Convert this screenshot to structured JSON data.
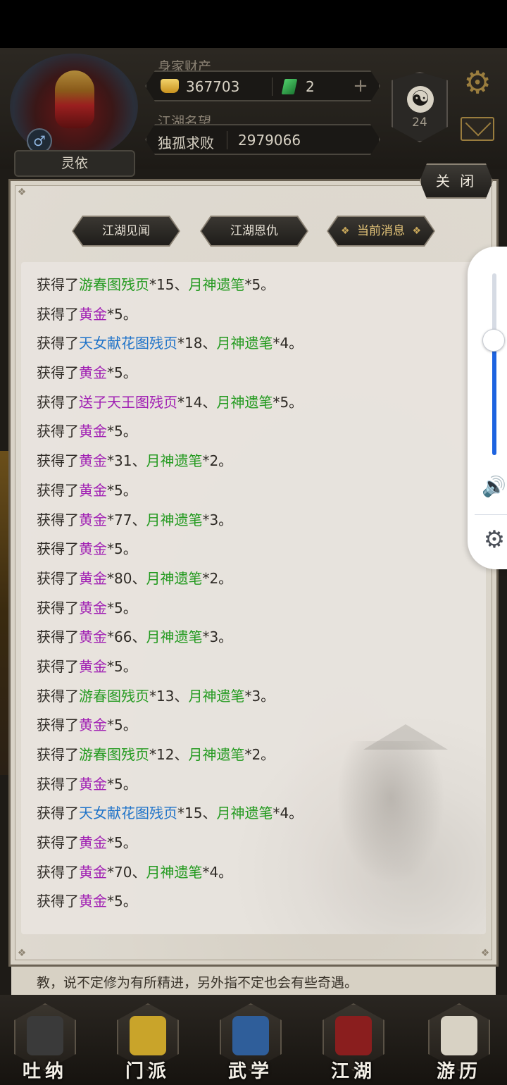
{
  "header": {
    "player_name": "灵依",
    "gender_symbol": "♂",
    "wealth_label": "身家财产",
    "gold_amount": "367703",
    "jade_amount": "2",
    "plus_symbol": "+",
    "fame_label": "江湖名望",
    "fame_title": "独孤求败",
    "fame_value": "2979066",
    "taiji_symbol": "☯",
    "taiji_level": "24",
    "settings_symbol": "⚙"
  },
  "modal": {
    "close_label": "关 闭",
    "tabs": [
      {
        "label": "江湖见闻",
        "active": false
      },
      {
        "label": "江湖恩仇",
        "active": false
      },
      {
        "label": "当前消息",
        "active": true
      }
    ],
    "messages": [
      [
        {
          "t": "获得了",
          "c": "plain"
        },
        {
          "t": "游春图残页",
          "c": "green"
        },
        {
          "t": "*15、",
          "c": "plain"
        },
        {
          "t": "月神遗笔",
          "c": "green"
        },
        {
          "t": "*5。",
          "c": "plain"
        }
      ],
      [
        {
          "t": "获得了",
          "c": "plain"
        },
        {
          "t": "黄金",
          "c": "purple"
        },
        {
          "t": "*5。",
          "c": "plain"
        }
      ],
      [
        {
          "t": "获得了",
          "c": "plain"
        },
        {
          "t": "天女献花图残页",
          "c": "blue"
        },
        {
          "t": "*18、",
          "c": "plain"
        },
        {
          "t": "月神遗笔",
          "c": "green"
        },
        {
          "t": "*4。",
          "c": "plain"
        }
      ],
      [
        {
          "t": "获得了",
          "c": "plain"
        },
        {
          "t": "黄金",
          "c": "purple"
        },
        {
          "t": "*5。",
          "c": "plain"
        }
      ],
      [
        {
          "t": "获得了",
          "c": "plain"
        },
        {
          "t": "送子天王图残页",
          "c": "purple"
        },
        {
          "t": "*14、",
          "c": "plain"
        },
        {
          "t": "月神遗笔",
          "c": "green"
        },
        {
          "t": "*5。",
          "c": "plain"
        }
      ],
      [
        {
          "t": "获得了",
          "c": "plain"
        },
        {
          "t": "黄金",
          "c": "purple"
        },
        {
          "t": "*5。",
          "c": "plain"
        }
      ],
      [
        {
          "t": "获得了",
          "c": "plain"
        },
        {
          "t": "黄金",
          "c": "purple"
        },
        {
          "t": "*31、",
          "c": "plain"
        },
        {
          "t": "月神遗笔",
          "c": "green"
        },
        {
          "t": "*2。",
          "c": "plain"
        }
      ],
      [
        {
          "t": "获得了",
          "c": "plain"
        },
        {
          "t": "黄金",
          "c": "purple"
        },
        {
          "t": "*5。",
          "c": "plain"
        }
      ],
      [
        {
          "t": "获得了",
          "c": "plain"
        },
        {
          "t": "黄金",
          "c": "purple"
        },
        {
          "t": "*77、",
          "c": "plain"
        },
        {
          "t": "月神遗笔",
          "c": "green"
        },
        {
          "t": "*3。",
          "c": "plain"
        }
      ],
      [
        {
          "t": "获得了",
          "c": "plain"
        },
        {
          "t": "黄金",
          "c": "purple"
        },
        {
          "t": "*5。",
          "c": "plain"
        }
      ],
      [
        {
          "t": "获得了",
          "c": "plain"
        },
        {
          "t": "黄金",
          "c": "purple"
        },
        {
          "t": "*80、",
          "c": "plain"
        },
        {
          "t": "月神遗笔",
          "c": "green"
        },
        {
          "t": "*2。",
          "c": "plain"
        }
      ],
      [
        {
          "t": "获得了",
          "c": "plain"
        },
        {
          "t": "黄金",
          "c": "purple"
        },
        {
          "t": "*5。",
          "c": "plain"
        }
      ],
      [
        {
          "t": "获得了",
          "c": "plain"
        },
        {
          "t": "黄金",
          "c": "purple"
        },
        {
          "t": "*66、",
          "c": "plain"
        },
        {
          "t": "月神遗笔",
          "c": "green"
        },
        {
          "t": "*3。",
          "c": "plain"
        }
      ],
      [
        {
          "t": "获得了",
          "c": "plain"
        },
        {
          "t": "黄金",
          "c": "purple"
        },
        {
          "t": "*5。",
          "c": "plain"
        }
      ],
      [
        {
          "t": "获得了",
          "c": "plain"
        },
        {
          "t": "游春图残页",
          "c": "green"
        },
        {
          "t": "*13、",
          "c": "plain"
        },
        {
          "t": "月神遗笔",
          "c": "green"
        },
        {
          "t": "*3。",
          "c": "plain"
        }
      ],
      [
        {
          "t": "获得了",
          "c": "plain"
        },
        {
          "t": "黄金",
          "c": "purple"
        },
        {
          "t": "*5。",
          "c": "plain"
        }
      ],
      [
        {
          "t": "获得了",
          "c": "plain"
        },
        {
          "t": "游春图残页",
          "c": "green"
        },
        {
          "t": "*12、",
          "c": "plain"
        },
        {
          "t": "月神遗笔",
          "c": "green"
        },
        {
          "t": "*2。",
          "c": "plain"
        }
      ],
      [
        {
          "t": "获得了",
          "c": "plain"
        },
        {
          "t": "黄金",
          "c": "purple"
        },
        {
          "t": "*5。",
          "c": "plain"
        }
      ],
      [
        {
          "t": "获得了",
          "c": "plain"
        },
        {
          "t": "天女献花图残页",
          "c": "blue"
        },
        {
          "t": "*15、",
          "c": "plain"
        },
        {
          "t": "月神遗笔",
          "c": "green"
        },
        {
          "t": "*4。",
          "c": "plain"
        }
      ],
      [
        {
          "t": "获得了",
          "c": "plain"
        },
        {
          "t": "黄金",
          "c": "purple"
        },
        {
          "t": "*5。",
          "c": "plain"
        }
      ],
      [
        {
          "t": "获得了",
          "c": "plain"
        },
        {
          "t": "黄金",
          "c": "purple"
        },
        {
          "t": "*70、",
          "c": "plain"
        },
        {
          "t": "月神遗笔",
          "c": "green"
        },
        {
          "t": "*4。",
          "c": "plain"
        }
      ],
      [
        {
          "t": "获得了",
          "c": "plain"
        },
        {
          "t": "黄金",
          "c": "purple"
        },
        {
          "t": "*5。",
          "c": "plain"
        }
      ]
    ]
  },
  "background_hint": "教，说不定修为有所精进，另外指不定也会有些奇遇。",
  "volume": {
    "level": 0.63,
    "speaker_symbol": "🔊",
    "settings_symbol": "⚙"
  },
  "bottom_nav": [
    {
      "label": "吐纳",
      "icon": "meditation-icon",
      "art": "#3a3a3a"
    },
    {
      "label": "门派",
      "icon": "sect-banner-icon",
      "art": "#c9a42a"
    },
    {
      "label": "武学",
      "icon": "martial-book-icon",
      "art": "#2f5e9a"
    },
    {
      "label": "江湖",
      "icon": "straw-hat-icon",
      "art": "#8a1e1e"
    },
    {
      "label": "游历",
      "icon": "horse-icon",
      "art": "#d8d2c4"
    }
  ],
  "colors": {
    "green_item": "#239a1f",
    "purple_item": "#a01fb3",
    "blue_item": "#1f73c9",
    "active_tab": "#e7c77a",
    "volume_accent": "#1d63e0"
  }
}
